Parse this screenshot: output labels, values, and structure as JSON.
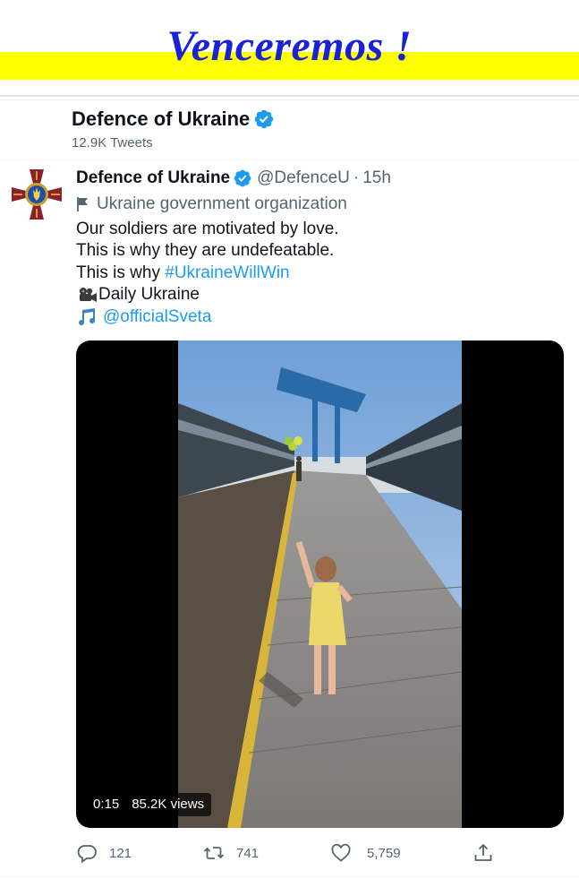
{
  "banner": {
    "slogan": "Venceremos !",
    "stripe_color": "#ffff00",
    "text_color": "#1a22d6"
  },
  "profile": {
    "name": "Defence of Ukraine",
    "tweet_count": "12.9K Tweets",
    "verified": true
  },
  "tweet": {
    "author_name": "Defence of Ukraine",
    "handle": "@DefenceU",
    "separator": "·",
    "time": "15h",
    "org_label": "Ukraine government organization",
    "lines": {
      "l1": "Our soldiers are motivated by love.",
      "l2": "This is why they are undefeatable.",
      "l3_text": "This is why ",
      "l3_hashtag": "#UkraineWillWin",
      "l4_emoji": "🎥",
      "l4_text": "Daily Ukraine",
      "l5_emoji": "🎶",
      "l5_mention": "@officialSveta"
    },
    "video": {
      "duration": "0:15",
      "views": "85.2K views"
    },
    "actions": {
      "reply": {
        "icon": "reply-icon",
        "count": "121"
      },
      "retweet": {
        "icon": "retweet-icon",
        "count": "741"
      },
      "like": {
        "icon": "like-icon",
        "count": "5,759"
      },
      "share": {
        "icon": "share-icon"
      }
    }
  },
  "colors": {
    "accent": "#1d9bf0",
    "muted": "#536471",
    "text": "#0f1419"
  }
}
